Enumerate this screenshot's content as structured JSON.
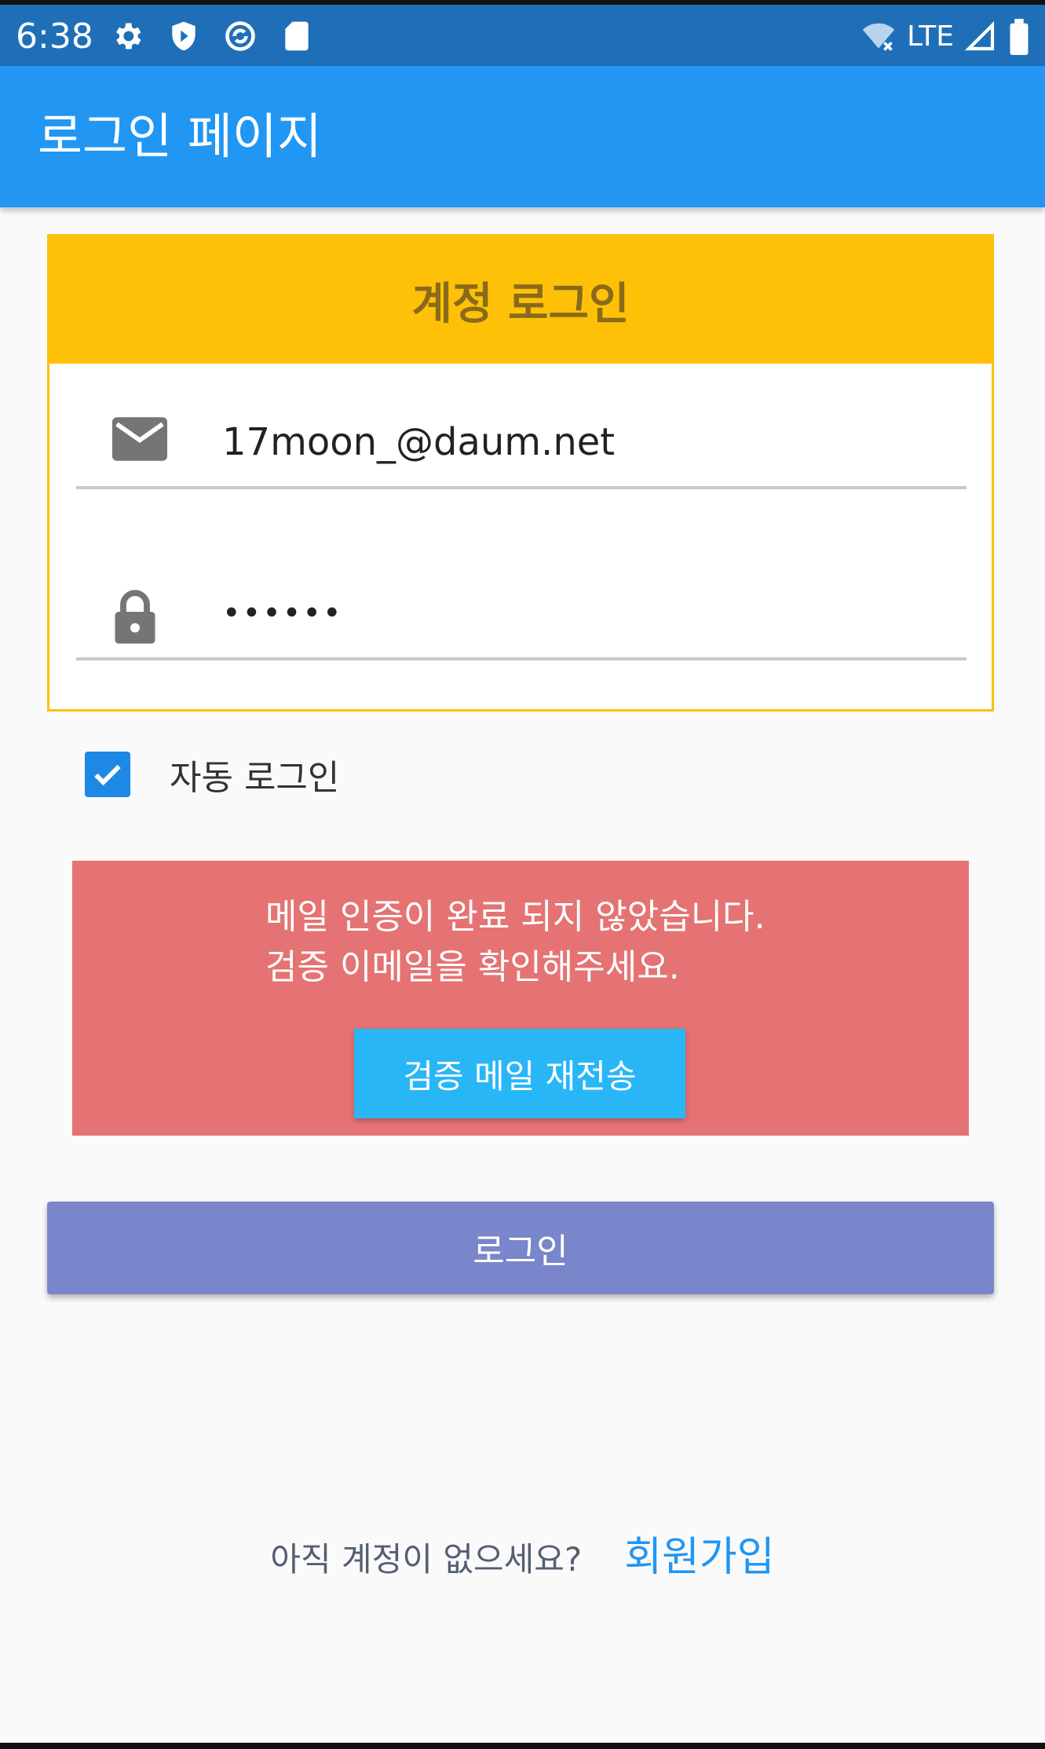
{
  "status_bar": {
    "time": "6:38",
    "network_label": "LTE",
    "icons": [
      "gear-icon",
      "shield-icon",
      "sync-icon",
      "sd-card-icon",
      "wifi-off-icon",
      "signal-icon",
      "battery-icon"
    ]
  },
  "app_bar": {
    "title": "로그인 페이지"
  },
  "login_card": {
    "title": "계정 로그인",
    "email": {
      "icon": "mail-icon",
      "value": "17moon_@daum.net"
    },
    "password": {
      "icon": "lock-icon",
      "value": "••••••"
    }
  },
  "auto_login": {
    "label": "자동 로그인",
    "checked": true
  },
  "error": {
    "line1": "메일 인증이 완료 되지 않았습니다.",
    "line2": "검증 이메일을 확인해주세요.",
    "resend_label": "검증 메일 재전송"
  },
  "login_button": {
    "label": "로그인"
  },
  "signup": {
    "question": "아직 계정이 없으세요?",
    "link_label": "회원가입"
  },
  "colors": {
    "status_bar": "#1e6fb8",
    "app_bar": "#2196f3",
    "card_accent": "#ffc107",
    "error_bg": "#e57373",
    "resend_button": "#29b6f6",
    "login_button": "#7986cb",
    "link": "#2196f3"
  }
}
